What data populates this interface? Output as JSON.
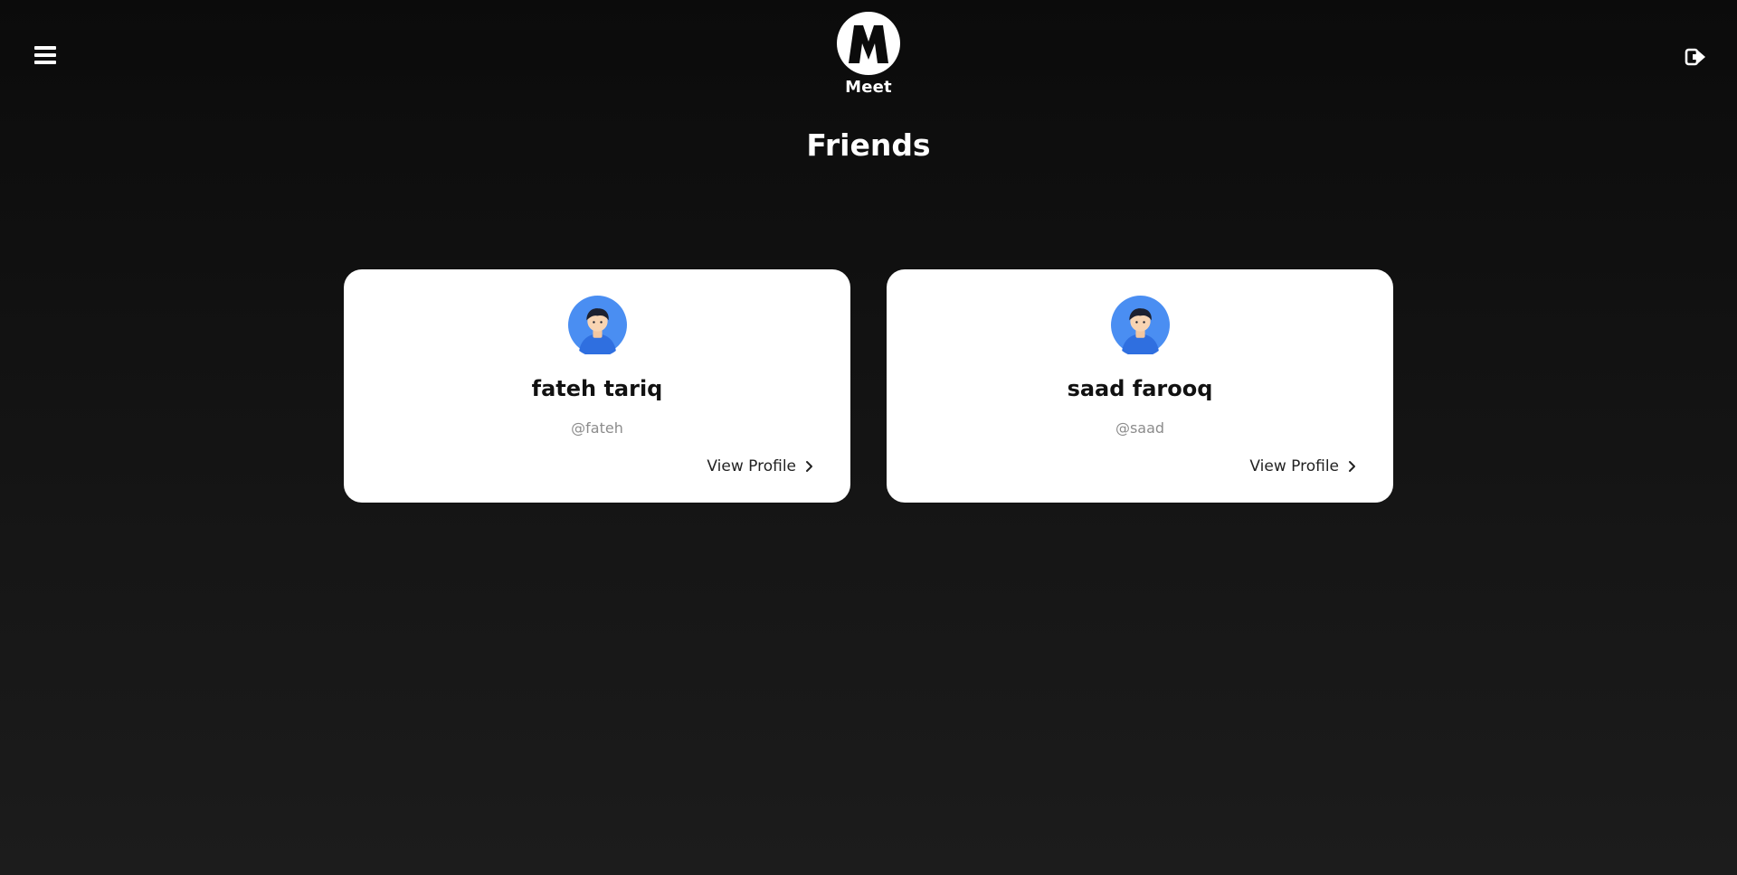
{
  "header": {
    "menu_icon": "hamburger-menu-icon",
    "logout_icon": "sign-out-icon",
    "brand_letter": "M",
    "brand_name": "Meet"
  },
  "page": {
    "title": "Friends"
  },
  "friends": [
    {
      "name": "fateh tariq",
      "handle": "@fateh",
      "action_label": "View Profile"
    },
    {
      "name": "saad farooq",
      "handle": "@saad",
      "action_label": "View Profile"
    }
  ],
  "colors": {
    "background_top": "#0b0b0b",
    "background_bottom": "#1c1c1c",
    "card": "#ffffff",
    "avatar_bg": "#4a8ef2",
    "handle_text": "#8c8c8c"
  }
}
